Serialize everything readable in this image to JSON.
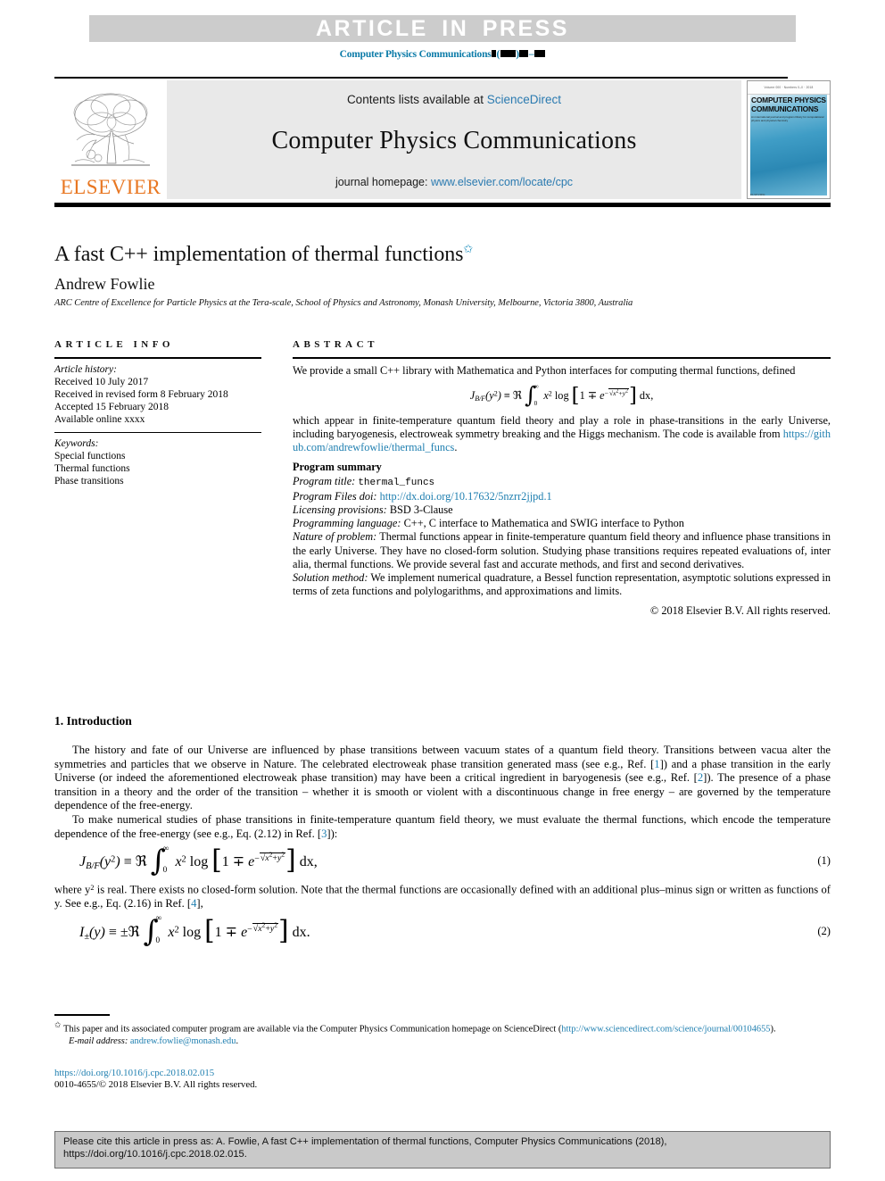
{
  "banner": {
    "text": "ARTICLE  IN  PRESS"
  },
  "running_head": {
    "journal": "Computer Physics Communications",
    "suffix_paren_open": "(",
    "suffix_paren_close": ")",
    "dash": "–"
  },
  "masthead": {
    "contents_prefix": "Contents lists available at ",
    "sciencedirect": "ScienceDirect",
    "journal_title": "Computer Physics Communications",
    "homepage_prefix": "journal homepage: ",
    "homepage_url": "www.elsevier.com/locate/cpc",
    "publisher": "ELSEVIER",
    "cover_title_line1": "COMPUTER PHYSICS",
    "cover_title_line2": "COMMUNICATIONS",
    "cover_subtitle": "An international journal and program library for computational physics and physical chemistry",
    "cover_topbar": "Volume 000  ·  Numbers 0–0  ·  2018",
    "cover_elsevier": "ELSEVIER"
  },
  "title_block": {
    "title": "A fast C++ implementation of thermal functions",
    "title_footnote_marker": "✩",
    "author": "Andrew Fowlie",
    "affiliation": "ARC Centre of Excellence for Particle Physics at the Tera-scale, School of Physics and Astronomy, Monash University, Melbourne, Victoria 3800, Australia"
  },
  "article_info": {
    "heading": "ARTICLE INFO",
    "history_label": "Article history:",
    "history": [
      "Received 10 July 2017",
      "Received in revised form 8 February 2018",
      "Accepted 15 February 2018",
      "Available online xxxx"
    ],
    "keywords_label": "Keywords:",
    "keywords": [
      "Special functions",
      "Thermal functions",
      "Phase transitions"
    ]
  },
  "abstract": {
    "heading": "ABSTRACT",
    "para1": "We provide a small C++ library with Mathematica and Python interfaces for computing thermal functions, defined",
    "para2_before_link": "which appear in finite-temperature quantum field theory and play a role in phase-transitions in the early Universe, including baryogenesis, electroweak symmetry breaking and the Higgs mechanism. The code is available from ",
    "github_link": "https://github.com/andrewfowlie/thermal_funcs",
    "para2_after_link": ".",
    "program_summary_heading": "Program summary",
    "program_title_label": "Program title:",
    "program_title_value": "thermal_funcs",
    "program_files_doi_label": "Program Files doi:",
    "program_files_doi_value": "http://dx.doi.org/10.17632/5nzrr2jjpd.1",
    "licensing_label": "Licensing provisions:",
    "licensing_value": "BSD 3-Clause",
    "language_label": "Programming language:",
    "language_value": "C++, C interface to Mathematica and SWIG interface to Python",
    "nature_label": "Nature of problem:",
    "nature_value": "Thermal functions appear in finite-temperature quantum field theory and influence phase transitions in the early Universe. They have no closed-form solution. Studying phase transitions requires repeated evaluations of, inter alia, thermal functions. We provide several fast and accurate methods, and first and second derivatives.",
    "solution_label": "Solution method:",
    "solution_value": "We implement numerical quadrature, a Bessel function representation, asymptotic solutions expressed in terms of zeta functions and polylogarithms, and approximations and limits.",
    "copyright": "© 2018 Elsevier B.V. All rights reserved."
  },
  "introduction": {
    "heading": "1. Introduction",
    "para1_a": "The history and fate of our Universe are influenced by phase transitions between vacuum states of a quantum field theory. Transitions between vacua alter the symmetries and particles that we observe in Nature. The celebrated electroweak phase transition generated mass (see e.g., Ref. [",
    "ref1": "1",
    "para1_b": "]) and a phase transition in the early Universe (or indeed the aforementioned electroweak phase transition) may have been a critical ingredient in baryogenesis (see e.g., Ref. [",
    "ref2": "2",
    "para1_c": "]). The presence of a phase transition in a theory and the order of the transition – whether it is smooth or violent with a discontinuous change in free energy – are governed by the temperature dependence of the free-energy.",
    "para2_a": "To make numerical studies of phase transitions in finite-temperature quantum field theory, we must evaluate the thermal functions, which encode the temperature dependence of the free-energy (see e.g., Eq. (2.12) in Ref. [",
    "ref3": "3",
    "para2_b": "]):",
    "eq1_number": "(1)",
    "para3_a": "where y",
    "para3_b": " is real. There exists no closed-form solution. Note that the thermal functions are occasionally defined with an additional plus–minus sign or written as functions of y. See e.g., Eq. (2.16) in Ref. [",
    "ref4": "4",
    "para3_c": "],",
    "eq2_number": "(2)"
  },
  "footnote": {
    "marker": "✩",
    "text_a": "This paper and its associated computer program are available via the Computer Physics Communication homepage on ScienceDirect (",
    "link": "http://www.sciencedirect.com/science/journal/00104655",
    "text_b": ").",
    "email_label": "E-mail address:",
    "email": "andrew.fowlie@monash.edu",
    "email_suffix": "."
  },
  "publication_info": {
    "doi": "https://doi.org/10.1016/j.cpc.2018.02.015",
    "issn_copyright": "0010-4655/© 2018 Elsevier B.V. All rights reserved."
  },
  "cite_box": {
    "line1": "Please  cite  this  article  in  press  as:  A.  Fowlie,  A  fast  C++  implementation  of  thermal  functions,  Computer  Physics  Communications  (2018),",
    "line2": "https://doi.org/10.1016/j.cpc.2018.02.015."
  },
  "colors": {
    "link": "#1f7fb0",
    "banner_bg": "#cccccc",
    "masthead_bg": "#e9e9e9",
    "elsevier_orange": "#e87722",
    "cite_bg": "#c9c9c9"
  }
}
